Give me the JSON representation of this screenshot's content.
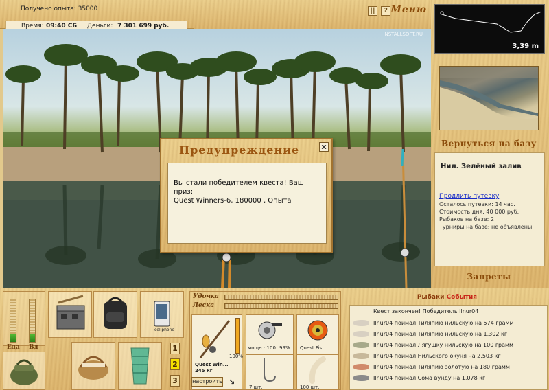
{
  "top_info": {
    "experience_label": "Получено опыта:",
    "experience_value": "35000",
    "time_label": "Время:",
    "time_value": "09:40 СБ",
    "money_label": "Деньги:",
    "money_value": "7 301 699 руб."
  },
  "top_bar": {
    "pause_icon": "pause-icon",
    "help_label": "?",
    "menu_label": "Меню"
  },
  "scene": {
    "watermark": "INSTALLSOFT.RU"
  },
  "dialog": {
    "title": "Предупреждение",
    "close_label": "x",
    "message_line1": "Вы стали победителем квеста! Ваш приз:",
    "message_line2": "Quest Winners-6, 180000 , Опыта"
  },
  "depth": {
    "value": "3,39 m"
  },
  "right": {
    "return_label": "Вернуться на базу",
    "location_title": "Нил. Зелёный залив",
    "extend_link": "Продлить путевку",
    "lines": [
      "Осталось путевки: 14 час.",
      "Стоимость дня: 40 000 руб.",
      "Рыбаков на базе: 2",
      "Турниры на базе: не объявлены"
    ],
    "bans_label": "Запреты"
  },
  "meters": {
    "food_label": "Еда",
    "water_label": "Вд",
    "food_level": 0.18,
    "water_level": 0.18
  },
  "slots": {
    "numbers": [
      "1",
      "2",
      "3"
    ],
    "active_number": "2",
    "phone_label": "cellphone"
  },
  "gear": {
    "rod_label": "Удочка",
    "line_label": "Леска",
    "rod_name": "Quest Win...",
    "rod_weight": "245 кг",
    "rod_condition": "100%",
    "reel_power": "мощн.: 100",
    "reel_condition": "99%",
    "line_name": "Quest Fis...",
    "hook_count": "7 шт.",
    "bait_count": "100 шт.",
    "setup_label": "настроить"
  },
  "events": {
    "title_part1": "Рыбаки",
    "title_part2": "События",
    "items": [
      "Квест закончен! Победитель Ilnur04",
      "Ilnur04 поймал Тиляпию нильскую на 574 грамм",
      "Ilnur04 поймал Тиляпию нильскую на 1,302 кг",
      "Ilnur04 поймал Лягушку нильскую на 100 грамм",
      "Ilnur04 поймал Нильского окуня на 2,503 кг",
      "Ilnur04 поймал Тиляпию золотую на 180 грамм",
      "Ilnur04 поймал Сома вунду на 1,078 кг"
    ]
  },
  "colors": {
    "accent_gold": "#8a4b0a",
    "link_blue": "#1a2ec8",
    "meter_green": "#3c9a22"
  }
}
